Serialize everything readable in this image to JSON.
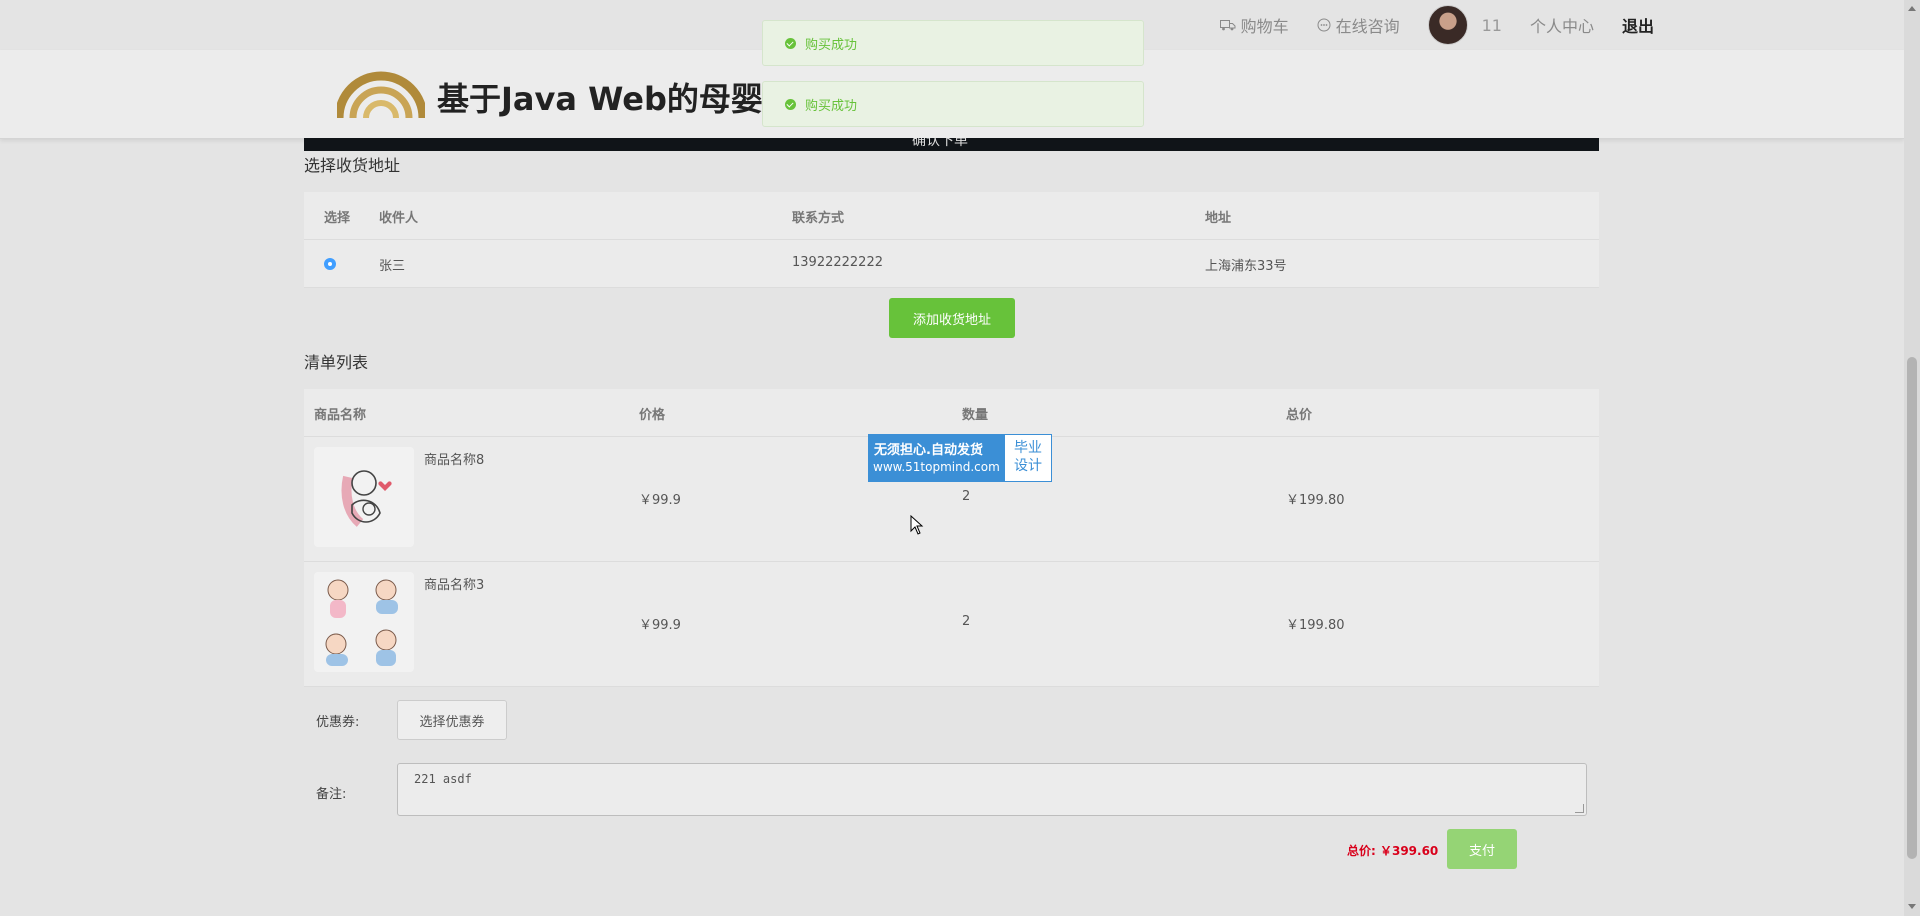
{
  "topnav": {
    "cart": "购物车",
    "consult": "在线咨询",
    "user_number": "11",
    "profile": "个人中心",
    "logout": "退出"
  },
  "site": {
    "title": "基于Java Web的母婴用品销售系统的设计与实现"
  },
  "toasts": [
    "购买成功",
    "购买成功"
  ],
  "page": {
    "heading_partial": "确认下单"
  },
  "address": {
    "section_title": "选择收货地址",
    "headers": [
      "选择",
      "收件人",
      "联系方式",
      "地址"
    ],
    "rows": [
      {
        "selected": true,
        "name": "张三",
        "phone": "13922222222",
        "address": "上海浦东33号"
      }
    ],
    "add_button": "添加收货地址"
  },
  "cart": {
    "section_title": "清单列表",
    "headers": [
      "商品名称",
      "价格",
      "数量",
      "总价"
    ],
    "items": [
      {
        "name": "商品名称8",
        "price": "￥99.9",
        "qty": "2",
        "total": "￥199.80",
        "image": "mother-baby-icon"
      },
      {
        "name": "商品名称3",
        "price": "￥99.9",
        "qty": "2",
        "total": "￥199.80",
        "image": "babies-icon"
      }
    ]
  },
  "coupon": {
    "label": "优惠券:",
    "button": "选择优惠券"
  },
  "note": {
    "label": "备注:",
    "value": "221 asdf"
  },
  "summary": {
    "total": "总价: ￥399.60",
    "pay_button": "支付"
  },
  "watermark": {
    "line1": "无须担心.自动发货",
    "line2": "www.51topmind.com",
    "right_line1": "毕业",
    "right_line2": "设计"
  },
  "colors": {
    "success": "#67c23a",
    "danger": "#d9001b",
    "primary": "#409eff"
  }
}
